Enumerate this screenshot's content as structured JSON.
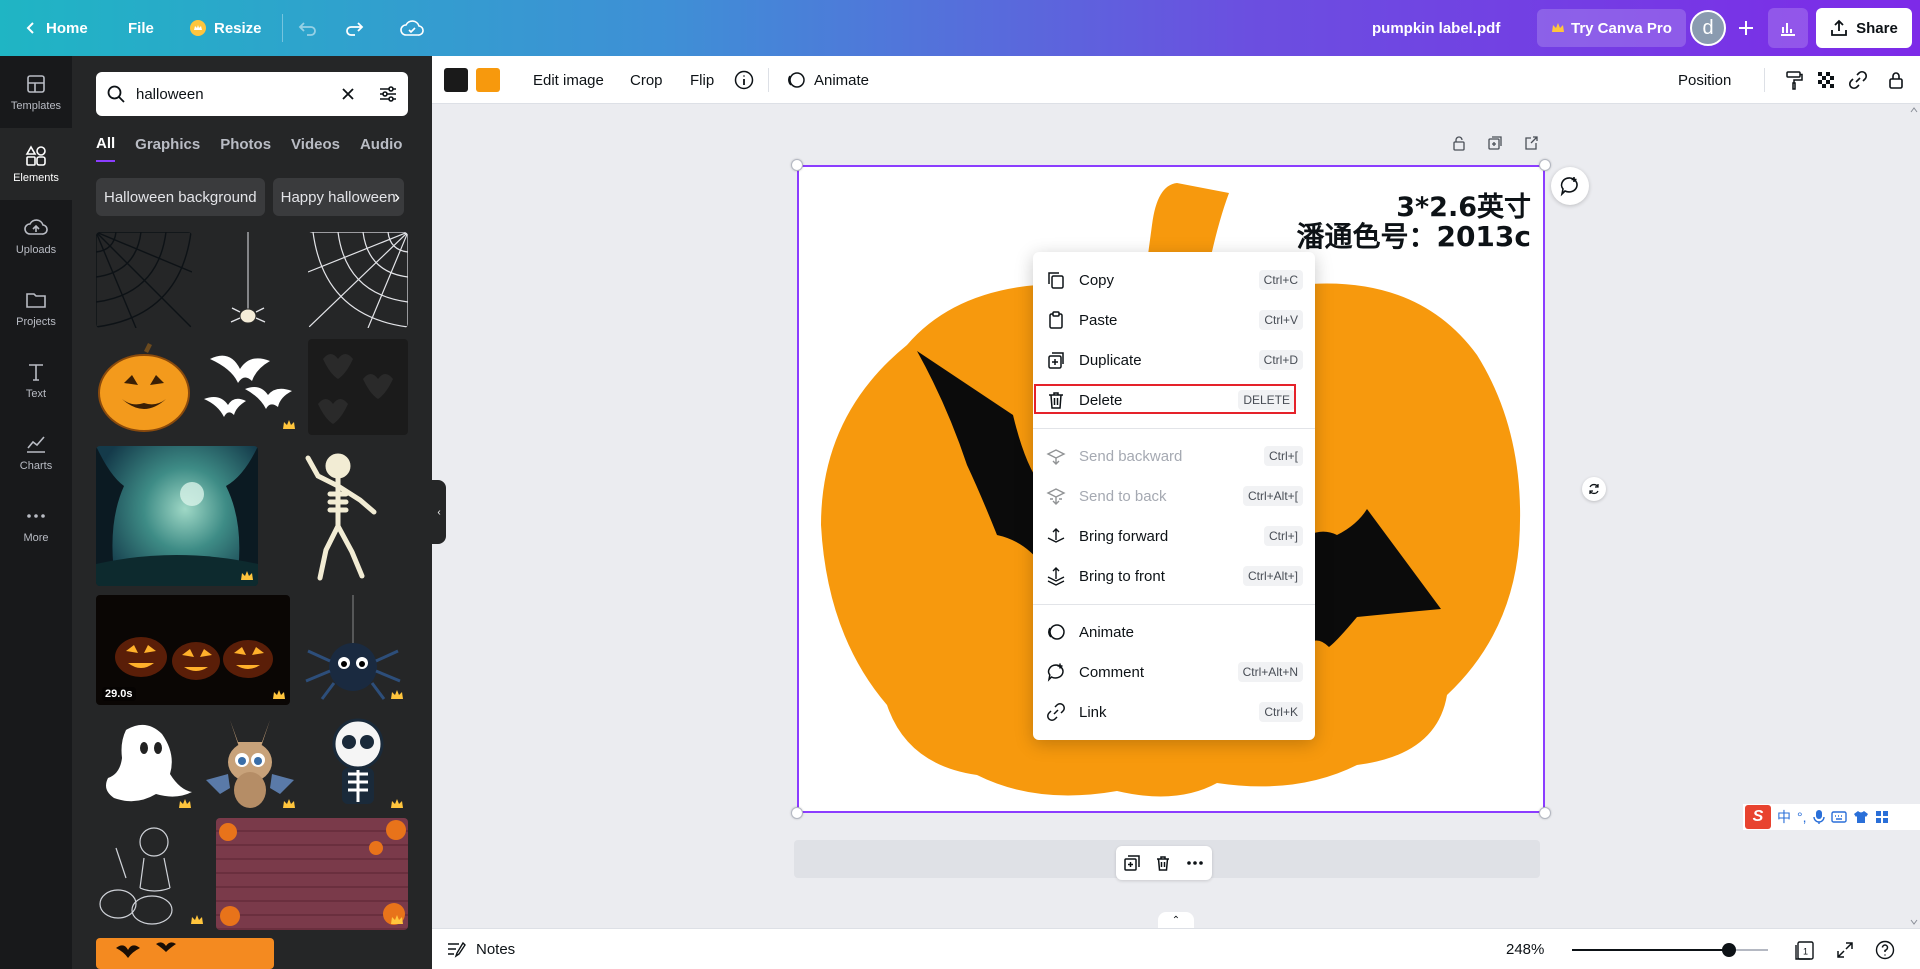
{
  "topbar": {
    "home_label": "Home",
    "file_label": "File",
    "resize_label": "Resize",
    "doc_title": "pumpkin label.pdf",
    "try_pro_label": "Try Canva Pro",
    "avatar_letter": "d",
    "share_label": "Share"
  },
  "rail": {
    "items": [
      {
        "label": "Templates",
        "icon": "templates-icon"
      },
      {
        "label": "Elements",
        "icon": "elements-icon"
      },
      {
        "label": "Uploads",
        "icon": "uploads-icon"
      },
      {
        "label": "Projects",
        "icon": "projects-icon"
      },
      {
        "label": "Text",
        "icon": "text-icon"
      },
      {
        "label": "Charts",
        "icon": "charts-icon"
      },
      {
        "label": "More",
        "icon": "more-icon"
      }
    ]
  },
  "panel": {
    "search_value": "halloween",
    "tabs": [
      "All",
      "Graphics",
      "Photos",
      "Videos",
      "Audio"
    ],
    "chips": [
      "Halloween background",
      "Happy halloween"
    ],
    "video_duration": "29.0s"
  },
  "editor_toolbar": {
    "color1": "#1a1a1a",
    "color2": "#f7990d",
    "edit_image_label": "Edit image",
    "crop_label": "Crop",
    "flip_label": "Flip",
    "animate_label": "Animate",
    "position_label": "Position"
  },
  "canvas": {
    "text_line1": "3*2.6英寸",
    "text_line2": "潘通色号：2013c",
    "pumpkin_color": "#f7990d",
    "accent": "#8b3dff"
  },
  "context_menu": {
    "items": [
      {
        "label": "Copy",
        "shortcut": "Ctrl+C",
        "disabled": false
      },
      {
        "label": "Paste",
        "shortcut": "Ctrl+V",
        "disabled": false
      },
      {
        "label": "Duplicate",
        "shortcut": "Ctrl+D",
        "disabled": false
      },
      {
        "label": "Delete",
        "shortcut": "DELETE",
        "disabled": false
      },
      {
        "label": "Send backward",
        "shortcut": "Ctrl+[",
        "disabled": true
      },
      {
        "label": "Send to back",
        "shortcut": "Ctrl+Alt+[",
        "disabled": true
      },
      {
        "label": "Bring forward",
        "shortcut": "Ctrl+]",
        "disabled": false
      },
      {
        "label": "Bring to front",
        "shortcut": "Ctrl+Alt+]",
        "disabled": false
      },
      {
        "label": "Animate",
        "shortcut": "",
        "disabled": false
      },
      {
        "label": "Comment",
        "shortcut": "Ctrl+Alt+N",
        "disabled": false
      },
      {
        "label": "Link",
        "shortcut": "Ctrl+K",
        "disabled": false
      }
    ]
  },
  "bottombar": {
    "notes_label": "Notes",
    "zoom_label": "248%",
    "zoom_level": 0.8,
    "page_number": "1"
  },
  "ime": {
    "logo": "S",
    "mode": "中"
  }
}
